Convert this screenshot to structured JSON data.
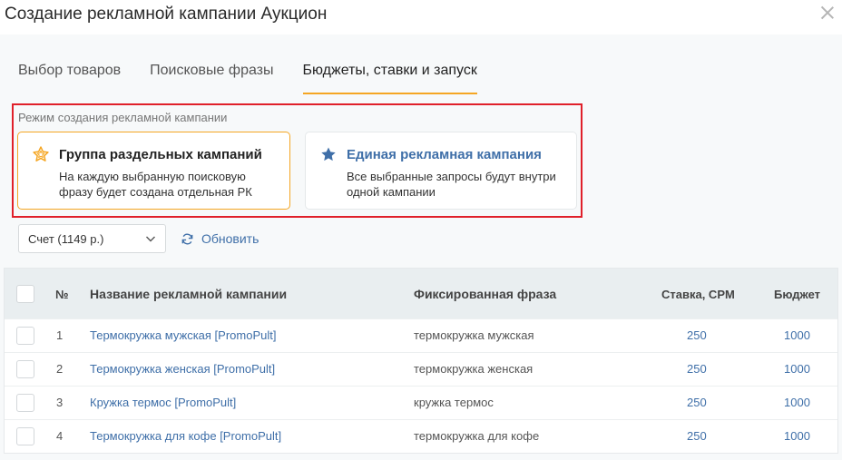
{
  "modal": {
    "title": "Создание рекламной кампании Аукцион"
  },
  "tabs": [
    {
      "label": "Выбор товаров"
    },
    {
      "label": "Поисковые фразы"
    },
    {
      "label": "Бюджеты, ставки и запуск"
    }
  ],
  "mode": {
    "label": "Режим создания рекламной кампании",
    "options": [
      {
        "title": "Группа раздельных кампаний",
        "description": "На каждую выбранную поисковую фразу будет создана отдельная РК",
        "icon": "star-outline-icon"
      },
      {
        "title": "Единая рекламная кампания",
        "description": "Все выбранные запросы будут внутри одной кампании",
        "icon": "star-filled-icon"
      }
    ]
  },
  "controls": {
    "account_select": "Счет (1149 р.)",
    "refresh_label": "Обновить"
  },
  "table": {
    "headers": {
      "num": "№",
      "name": "Название рекламной кампании",
      "phrase": "Фиксированная фраза",
      "bid": "Ставка, CPM",
      "budget": "Бюджет"
    },
    "rows": [
      {
        "num": "1",
        "name": "Термокружка мужская [PromoPult]",
        "phrase": "термокружка мужская",
        "bid": "250",
        "budget": "1000"
      },
      {
        "num": "2",
        "name": "Термокружка женская [PromoPult]",
        "phrase": "термокружка женская",
        "bid": "250",
        "budget": "1000"
      },
      {
        "num": "3",
        "name": "Кружка термос [PromoPult]",
        "phrase": "кружка термос",
        "bid": "250",
        "budget": "1000"
      },
      {
        "num": "4",
        "name": "Термокружка для кофе [PromoPult]",
        "phrase": "термокружка для кофе",
        "bid": "250",
        "budget": "1000"
      }
    ]
  },
  "colors": {
    "accent": "#f5a623",
    "link": "#3f6fa8",
    "highlight": "#e0202a"
  }
}
